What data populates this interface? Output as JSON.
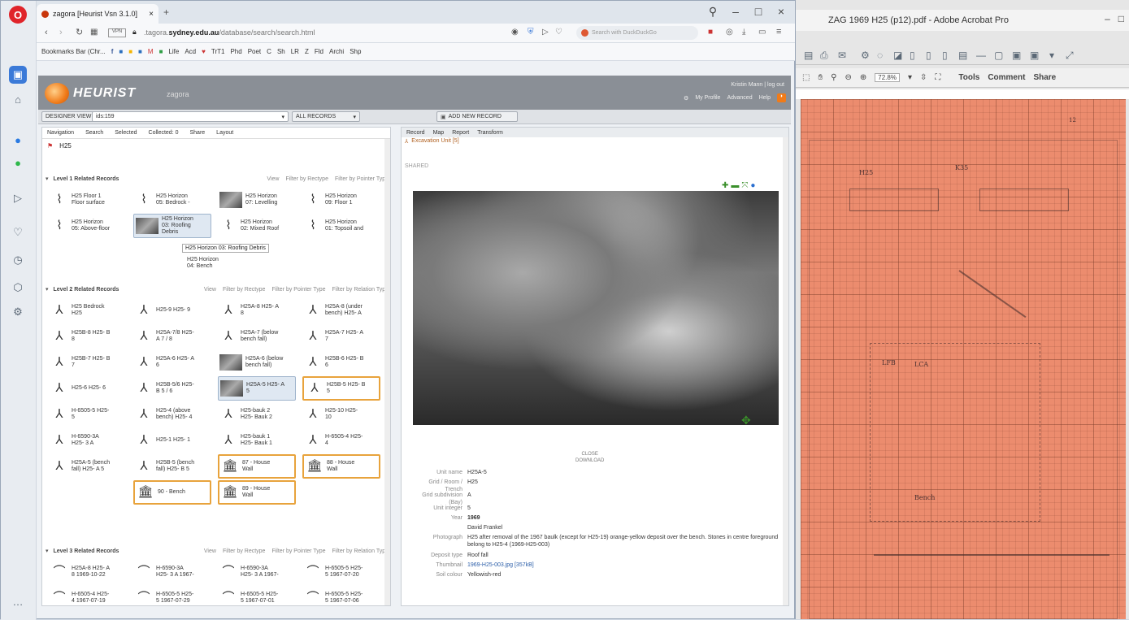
{
  "browser": {
    "tab_title": "zagora [Heurist Vsn 3.1.0]",
    "url_prefix": ".tagora.",
    "url_domain": "sydney.edu.au",
    "url_path": "/database/search/search.html",
    "search_placeholder": "Search with DuckDuckGo",
    "bookmarks": [
      "Bookmarks Bar (Chr...",
      "Life",
      "Acd",
      "TrT1",
      "Phd",
      "Poet",
      "C",
      "Sh",
      "LR",
      "Z",
      "Fld",
      "Archi",
      "Shp"
    ]
  },
  "heurist": {
    "logo": "HEURIST",
    "db_name": "zagora",
    "user": "Kristin Mann",
    "logout": "log out",
    "my_profile": "My Profile",
    "advanced": "Advanced",
    "help": "Help",
    "designer_view": "DESIGNER VIEW",
    "query": "ids:159",
    "all_records": "ALL RECORDS",
    "add_record": "ADD NEW RECORD"
  },
  "left": {
    "tabs": [
      "Navigation",
      "Search",
      "Selected",
      "Collected: 0",
      "Share",
      "Layout"
    ],
    "breadcrumb": "H25",
    "level1": {
      "title": "Level 1 Related Records",
      "view": "View",
      "by_rectype": "Filter by Rectype",
      "by_pointer": "Filter by Pointer Type",
      "cards": [
        [
          "H25 Floor 1",
          "Floor surface"
        ],
        [
          "H25 Horizon",
          "05: Bedrock -"
        ],
        [
          "H25 Horizon",
          "07: Levelling"
        ],
        [
          "H25 Horizon",
          "09: Floor 1"
        ],
        [
          "H25 Horizon",
          "05: Above-floor"
        ],
        [
          "H25 Horizon",
          "03: Roofing",
          "Debris"
        ],
        [
          "H25 Horizon",
          "02: Mixed Roof"
        ],
        [
          "H25 Horizon",
          "01: Topsoil and"
        ],
        [
          "H25 Horizon",
          "04: Bench"
        ]
      ],
      "tooltip": "H25 Horizon 03: Roofing Debris"
    },
    "level2": {
      "title": "Level 2 Related Records",
      "view": "View",
      "by_rectype": "Filter by Rectype",
      "by_pointer": "Filter by Pointer Type",
      "by_relation": "Filter by Relation Type",
      "cards": [
        [
          "H25 Bedrock",
          "H25"
        ],
        [
          "H25-9 H25- 9",
          ""
        ],
        [
          "H25A-8 H25- A",
          "8"
        ],
        [
          "H25A-8 (under",
          "bench) H25- A"
        ],
        [
          "H25B-8 H25- B",
          "8"
        ],
        [
          "H25A-7/8 H25-",
          "A 7 / 8"
        ],
        [
          "H25A-7 (below",
          "bench fall)"
        ],
        [
          "H25A-7 H25- A",
          "7"
        ],
        [
          "H25B-7 H25- B",
          "7"
        ],
        [
          "H25A-6 H25- A",
          "6"
        ],
        [
          "H25A-6 (below",
          "bench fall)"
        ],
        [
          "H25B-6 H25- B",
          "6"
        ],
        [
          "H25-6 H25- 6",
          ""
        ],
        [
          "H25B-5/6 H25-",
          "B 5 / 6"
        ],
        [
          "H25A-5 H25- A",
          "5"
        ],
        [
          "H25B-5 H25- B",
          "5"
        ],
        [
          "H-6505-5 H25-",
          "5"
        ],
        [
          "H25-4 (above",
          "bench) H25- 4"
        ],
        [
          "H25-bauk 2",
          "H25- Bauk 2"
        ],
        [
          "H25-10 H25-",
          "10"
        ],
        [
          "H-6590-3A",
          "H25- 3 A"
        ],
        [
          "H25-1 H25- 1",
          ""
        ],
        [
          "H25-bauk 1",
          "H25- Bauk 1"
        ],
        [
          "H-6505-4 H25-",
          "4"
        ],
        [
          "H25A-5 (bench",
          "fall) H25- A 5"
        ],
        [
          "H25B-5 (bench",
          "fall) H25- B 5"
        ],
        [
          "87 - House",
          "Wall"
        ],
        [
          "88 - House",
          "Wall"
        ],
        [
          "90 - Bench",
          ""
        ],
        [
          "89 - House",
          "Wall"
        ]
      ]
    },
    "level3": {
      "title": "Level 3 Related Records",
      "view": "View",
      "by_rectype": "Filter by Rectype",
      "by_pointer": "Filter by Pointer Type",
      "by_relation": "Filter by Relation Type",
      "cards": [
        [
          "H25A-8 H25- A",
          "8 1969-10-22"
        ],
        [
          "H-6590-3A",
          "H25- 3 A 1967-"
        ],
        [
          "H-6590-3A",
          "H25- 3 A 1967-"
        ],
        [
          "H-6505-5 H25-",
          "5 1967-07-20"
        ],
        [
          "H-6505-4 H25-",
          "4 1967-07-19"
        ],
        [
          "H-6505-5 H25-",
          "5 1967-07-29"
        ],
        [
          "H-6505-5 H25-",
          "5 1967-07-01"
        ],
        [
          "H-6505-5 H25-",
          "5 1967-07-06"
        ]
      ]
    }
  },
  "right": {
    "tabs": [
      "Record",
      "Map",
      "Report",
      "Transform"
    ],
    "record_type": "Excavation Unit [5]",
    "shared": "SHARED",
    "close": "CLOSE",
    "download": "DOWNLOAD",
    "fields": [
      {
        "k": "Unit name",
        "v": "H25A-5"
      },
      {
        "k": "Grid / Room / Trench",
        "v": "H25"
      },
      {
        "k": "Grid subdivision (Bay)",
        "v": "A"
      },
      {
        "k": "Unit integer",
        "v": "5"
      },
      {
        "k": "Year",
        "v": "1969"
      },
      {
        "k": "",
        "v": "David Frankel"
      },
      {
        "k": "Photograph",
        "v": "H25 after removal of the 1967 baulk (except for H25-19) orange-yellow deposit over the bench. Stones in centre foreground belong to H25-4 (1969-H25-003)"
      },
      {
        "k": "Deposit type",
        "v": "Roof fall"
      },
      {
        "k": "Thumbnail",
        "v": "1969-H25-003.jpg [357kB]"
      },
      {
        "k": "Soil colour",
        "v": "Yellowish-red"
      }
    ]
  },
  "acrobat": {
    "title": "ZAG 1969 H25 (p12).pdf - Adobe Acrobat Pro",
    "zoom": "72.8%",
    "tools": "Tools",
    "comment": "Comment",
    "share": "Share",
    "page_labels": [
      "H25",
      "K35",
      "LFB",
      "LCA",
      "Bench",
      "12"
    ]
  }
}
